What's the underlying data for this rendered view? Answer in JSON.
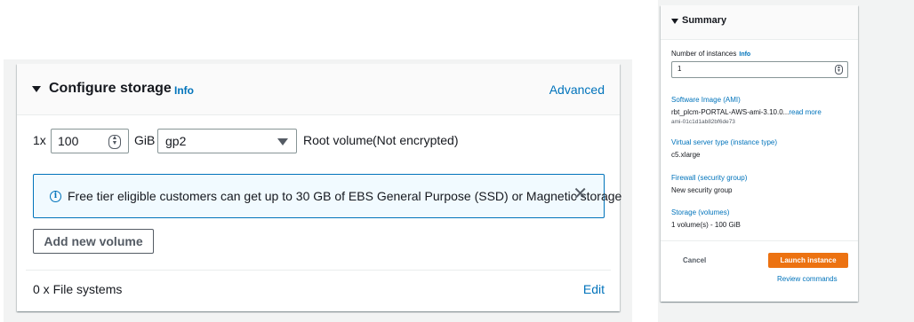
{
  "storage": {
    "title": "Configure storage",
    "info_label": "Info",
    "advanced_label": "Advanced",
    "volume_row": {
      "count_prefix": "1x",
      "size_value": "100",
      "unit": "GiB",
      "volume_type": "gp2",
      "volume_label": "Root volume",
      "encryption_status": "(Not encrypted)"
    },
    "flash_message": "Free tier eligible customers can get up to 30 GB of EBS General Purpose (SSD) or Magnetic storage",
    "add_volume_label": "Add new volume",
    "file_systems_label": "0 x File systems",
    "edit_label": "Edit"
  },
  "summary": {
    "title": "Summary",
    "instances_label": "Number of instances",
    "instances_info": "Info",
    "instances_value": "1",
    "ami_label": "Software Image (AMI)",
    "ami_name": "rbt_plcm-PORTAL-AWS-ami-3.10.0...",
    "ami_read_more": "read more",
    "ami_id": "ami-01c1d1ab82bf6de73",
    "instance_type_label": "Virtual server type (instance type)",
    "instance_type_value": "c5.xlarge",
    "firewall_label": "Firewall (security group)",
    "firewall_value": "New security group",
    "storage_label": "Storage (volumes)",
    "storage_value": "1 volume(s) - 100 GiB",
    "cancel_label": "Cancel",
    "launch_label": "Launch instance",
    "review_label": "Review commands"
  },
  "colors": {
    "link": "#0073bb",
    "primary_button": "#ec7211",
    "flash_background": "#f1faff",
    "page_background": "#f2f3f3"
  },
  "icons": [
    "caret-down-icon",
    "info-circle-icon",
    "close-icon",
    "stepper-icon"
  ]
}
